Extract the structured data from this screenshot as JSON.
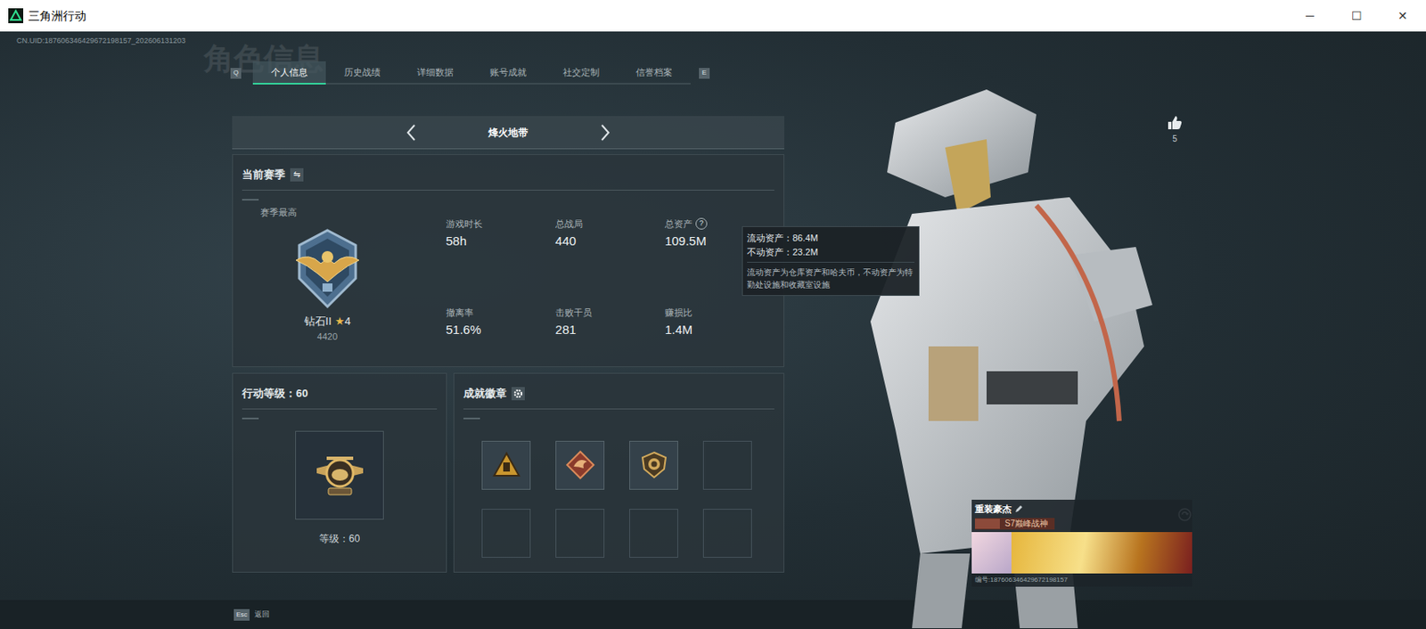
{
  "window": {
    "title": "三角洲行动",
    "controls": [
      "─",
      "☐",
      "✕"
    ]
  },
  "uid": "CN.UID:187606346429672198157_202606131203",
  "watermark": "角色信息",
  "tabs": {
    "prev_key": "Q",
    "next_key": "E",
    "items": [
      {
        "label": "个人信息",
        "selected": true
      },
      {
        "label": "历史战绩",
        "selected": false
      },
      {
        "label": "详细数据",
        "selected": false
      },
      {
        "label": "账号成就",
        "selected": false
      },
      {
        "label": "社交定制",
        "selected": false
      },
      {
        "label": "信誉档案",
        "selected": false
      }
    ]
  },
  "mode_selector": {
    "label": "烽火地带"
  },
  "season": {
    "title": "当前赛季",
    "best_label": "赛季最高",
    "rank": "钻石II",
    "star": "★",
    "stars": "4",
    "score": "4420",
    "stats": [
      {
        "label": "游戏时长",
        "value": "58h",
        "help_mark": ""
      },
      {
        "label": "总战局",
        "value": "440",
        "help_mark": ""
      },
      {
        "label": "总资产",
        "value": "109.5M",
        "help_mark": "?"
      },
      {
        "label": "撤离率",
        "value": "51.6%",
        "help_mark": ""
      },
      {
        "label": "击败干员",
        "value": "281",
        "help_mark": ""
      },
      {
        "label": "赚损比",
        "value": "1.4M",
        "help_mark": ""
      }
    ]
  },
  "tooltip": {
    "lines": [
      "流动资产：86.4M",
      "不动资产：23.2M"
    ],
    "note": "流动资产为仓库资产和哈夫币，不动资产为特勤处设施和收藏室设施"
  },
  "level": {
    "title": "行动等级：60",
    "caption": "等级：60"
  },
  "achievements": {
    "title": "成就徽章",
    "slots": [
      {
        "kind": "warning"
      },
      {
        "kind": "dragon"
      },
      {
        "kind": "lion"
      },
      {
        "kind": "empty"
      },
      {
        "kind": "empty"
      },
      {
        "kind": "empty"
      },
      {
        "kind": "empty"
      },
      {
        "kind": "empty"
      }
    ]
  },
  "likes": "5",
  "profile_card": {
    "title": "重装豪杰",
    "tag": "S7巅峰战神",
    "id": "编号:187606346429672198157"
  },
  "footer": {
    "key": "Esc",
    "label": "返回"
  }
}
